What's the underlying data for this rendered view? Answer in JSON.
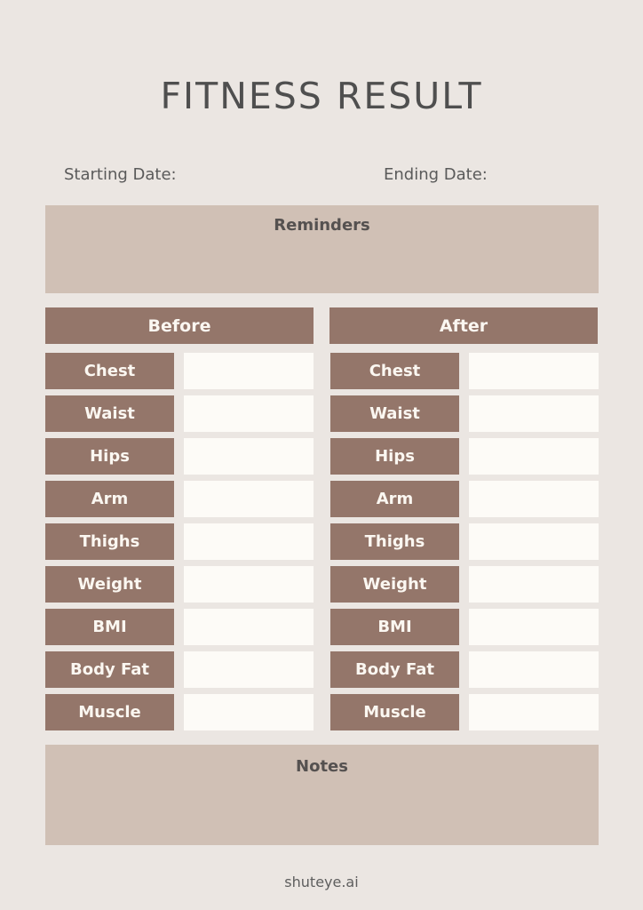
{
  "title": "FITNESS RESULT",
  "dates": {
    "starting_label": "Starting Date:",
    "ending_label": "Ending Date:"
  },
  "reminders": {
    "title": "Reminders"
  },
  "before": {
    "header": "Before",
    "rows": [
      "Chest",
      "Waist",
      "Hips",
      "Arm",
      "Thighs",
      "Weight",
      "BMI",
      "Body Fat",
      "Muscle"
    ]
  },
  "after": {
    "header": "After",
    "rows": [
      "Chest",
      "Waist",
      "Hips",
      "Arm",
      "Thighs",
      "Weight",
      "BMI",
      "Body Fat",
      "Muscle"
    ]
  },
  "notes": {
    "title": "Notes"
  },
  "footer": "shuteye.ai",
  "colors": {
    "background": "#ebe6e2",
    "panel": "#d0c0b5",
    "label_fill": "#94766a",
    "value_fill": "#fdfbf7",
    "title_text": "#4f4f4f"
  }
}
